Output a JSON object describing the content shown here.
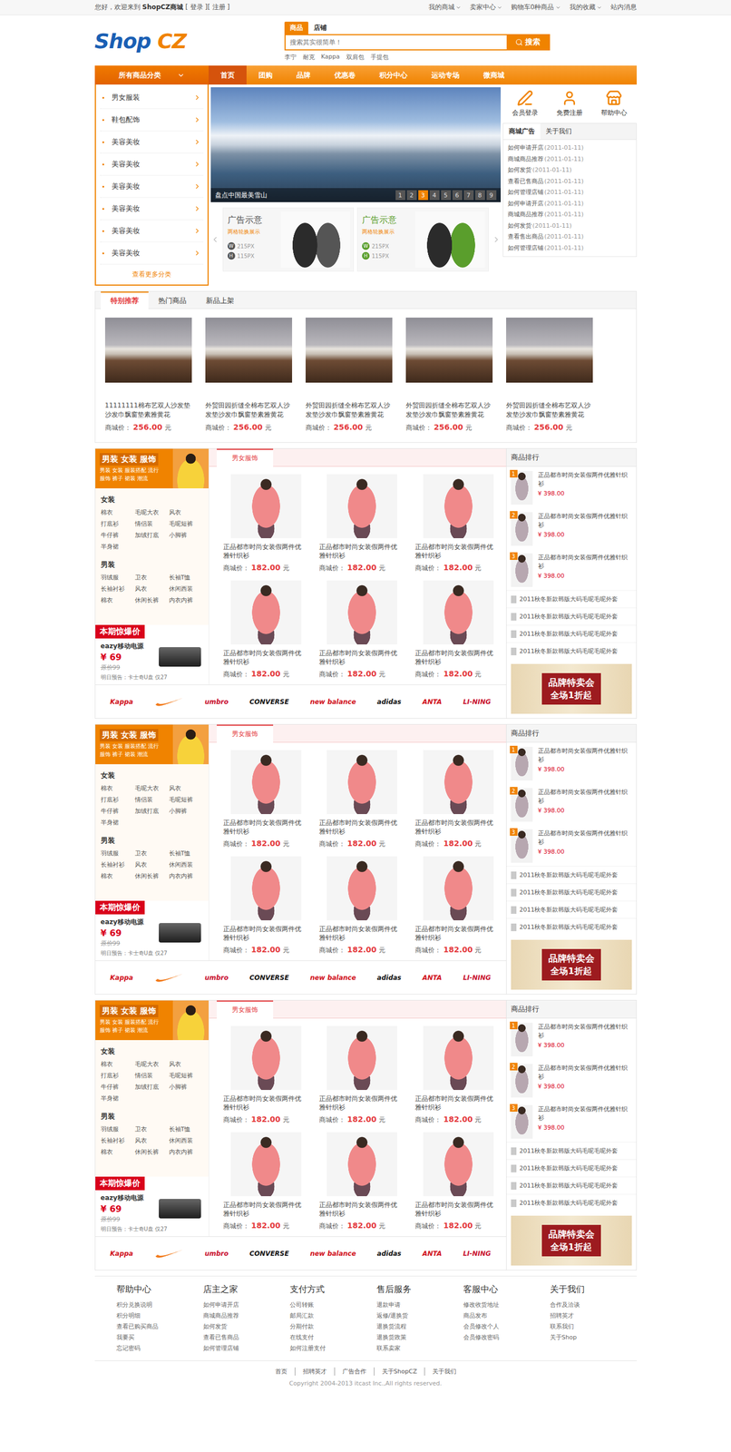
{
  "topbar": {
    "greeting": "您好，欢迎来到",
    "site": "ShopCZ商城",
    "login": "[ 登录 ]",
    "register": "[ 注册 ]",
    "links": [
      {
        "label": "我的商城",
        "menu": true
      },
      {
        "label": "卖家中心",
        "menu": true
      },
      {
        "label": "购物车0种商品",
        "menu": true
      },
      {
        "label": "我的收藏",
        "menu": true
      },
      {
        "label": "站内消息",
        "menu": false
      }
    ]
  },
  "logo": {
    "first": "Shop",
    "second": "CZ"
  },
  "search": {
    "tabs": [
      {
        "label": "商品",
        "selected": true
      },
      {
        "label": "店铺",
        "selected": false
      }
    ],
    "placeholder": "搜索其实很简单！",
    "button": "搜索",
    "hot": [
      "李宁",
      "耐克",
      "Kappa",
      "双肩包",
      "手提包"
    ]
  },
  "nav": {
    "category": "所有商品分类",
    "items": [
      {
        "label": "首页",
        "selected": true
      },
      {
        "label": "团购",
        "selected": false
      },
      {
        "label": "品牌",
        "selected": false
      },
      {
        "label": "优惠卷",
        "selected": false
      },
      {
        "label": "积分中心",
        "selected": false
      },
      {
        "label": "运动专场",
        "selected": false
      },
      {
        "label": "微商城",
        "selected": false
      }
    ]
  },
  "categories": {
    "items": [
      "男女服装",
      "鞋包配饰",
      "美容美妆",
      "美容美妆",
      "美容美妆",
      "美容美妆",
      "美容美妆",
      "美容美妆"
    ],
    "more": "查看更多分类"
  },
  "banner": {
    "caption": "盘点中国最美雪山",
    "pages": [
      {
        "label": "1",
        "selected": false
      },
      {
        "label": "2",
        "selected": false
      },
      {
        "label": "3",
        "selected": true
      },
      {
        "label": "4",
        "selected": false
      },
      {
        "label": "5",
        "selected": false
      },
      {
        "label": "6",
        "selected": false
      },
      {
        "label": "7",
        "selected": false
      },
      {
        "label": "8",
        "selected": false
      },
      {
        "label": "9",
        "selected": false
      }
    ]
  },
  "ads": [
    {
      "title": "广告示意",
      "sub": "两格轮换展示",
      "w": "W",
      "width": "215PX",
      "h": "H",
      "height": "115PX",
      "color": "#555555"
    },
    {
      "title": "广告示意",
      "sub": "两格轮换展示",
      "w": "W",
      "width": "215PX",
      "h": "H",
      "height": "115PX",
      "color": "#5a9e2c"
    }
  ],
  "quick": [
    {
      "label": "会员登录",
      "kind": "login"
    },
    {
      "label": "免费注册",
      "kind": "register"
    },
    {
      "label": "帮助中心",
      "kind": "help"
    }
  ],
  "notice": {
    "tabs": [
      {
        "label": "商城广告",
        "selected": true
      },
      {
        "label": "关于我们",
        "selected": false
      }
    ],
    "items": [
      {
        "title": "如何申请开店",
        "date": "(2011-01-11)"
      },
      {
        "title": "商城商品推荐",
        "date": "(2011-01-11)"
      },
      {
        "title": "如何发货",
        "date": "(2011-01-11)"
      },
      {
        "title": "查看已售商品",
        "date": "(2011-01-11)"
      },
      {
        "title": "如何管理店铺",
        "date": "(2011-01-11)"
      },
      {
        "title": "如何申请开店",
        "date": "(2011-01-11)"
      },
      {
        "title": "商城商品推荐",
        "date": "(2011-01-11)"
      },
      {
        "title": "如何发货",
        "date": "(2011-01-11)"
      },
      {
        "title": "查看售出商品",
        "date": "(2011-01-11)"
      },
      {
        "title": "如何管理店铺",
        "date": "(2011-01-11)"
      }
    ]
  },
  "recommend": {
    "tabs": [
      {
        "label": "特别推荐",
        "selected": true
      },
      {
        "label": "热门商品",
        "selected": false
      },
      {
        "label": "新品上架",
        "selected": false
      }
    ],
    "products": [
      {
        "name": "11111111棉布艺双人沙发垫沙发巾飘窗垫素雅黄花",
        "label": "商城价：",
        "price": "256.00",
        "unit": "元"
      },
      {
        "name": "外贸田园折缝全棉布艺双人沙发垫沙发巾飘窗垫素雅黄花",
        "label": "商城价：",
        "price": "256.00",
        "unit": "元"
      },
      {
        "name": "外贸田园折缝全棉布艺双人沙发垫沙发巾飘窗垫素雅黄花",
        "label": "商城价：",
        "price": "256.00",
        "unit": "元"
      },
      {
        "name": "外贸田园折缝全棉布艺双人沙发垫沙发巾飘窗垫素雅黄花",
        "label": "商城价：",
        "price": "256.00",
        "unit": "元"
      },
      {
        "name": "外贸田园折缝全棉布艺双人沙发垫沙发巾飘窗垫素雅黄花",
        "label": "商城价：",
        "price": "256.00",
        "unit": "元"
      }
    ]
  },
  "floors": [
    {
      "head": {
        "title": "男装 女装 服饰",
        "tags": [
          "男装 女装 服装搭配 流行",
          "服饰 裤子 裙装 潮流"
        ]
      },
      "groups": [
        {
          "title": "女装",
          "items": [
            "棉衣",
            "毛呢大衣",
            "风衣",
            "打底衫",
            "情侣装",
            "毛呢短裤",
            "牛仔裤",
            "加绒打底",
            "小脚裤",
            "半身裙"
          ]
        },
        {
          "title": "男装",
          "items": [
            "羽绒服",
            "卫衣",
            "长袖T恤",
            "长袖衬衫",
            "风衣",
            "休闲西装",
            "棉衣",
            "休闲长裤",
            "内衣内裤"
          ]
        }
      ],
      "deal": {
        "title": "本期惊爆价",
        "name": "eazy移动电源",
        "price": "¥ 69",
        "original": "原价99",
        "preview": "明日预告：卡士奇U盘 仅27"
      },
      "tabs": [
        {
          "label": "男女服饰",
          "selected": true
        }
      ],
      "products": [
        {
          "name": "正品都市时尚女装假两件优雅针织衫",
          "label": "商城价：",
          "price": "182.00",
          "unit": "元"
        },
        {
          "name": "正品都市时尚女装假两件优雅针织衫",
          "label": "商城价：",
          "price": "182.00",
          "unit": "元"
        },
        {
          "name": "正品都市时尚女装假两件优雅针织衫",
          "label": "商城价：",
          "price": "182.00",
          "unit": "元"
        },
        {
          "name": "正品都市时尚女装假两件优雅针织衫",
          "label": "商城价：",
          "price": "182.00",
          "unit": "元"
        },
        {
          "name": "正品都市时尚女装假两件优雅针织衫",
          "label": "商城价：",
          "price": "182.00",
          "unit": "元"
        },
        {
          "name": "正品都市时尚女装假两件优雅针织衫",
          "label": "商城价：",
          "price": "182.00",
          "unit": "元"
        }
      ],
      "ranking": {
        "title": "商品排行",
        "top": [
          {
            "rank": "1",
            "name": "正品都市时尚女装假两件优雅针织衫",
            "price": "¥ 398.00"
          },
          {
            "rank": "2",
            "name": "正品都市时尚女装假两件优雅针织衫",
            "price": "¥ 398.00"
          },
          {
            "rank": "3",
            "name": "正品都市时尚女装假两件优雅针织衫",
            "price": "¥ 398.00"
          }
        ],
        "more": [
          "2011秋冬新款韩版大码毛呢毛呢外套",
          "2011秋冬新款韩版大码毛呢毛呢外套",
          "2011秋冬新款韩版大码毛呢毛呢外套",
          "2011秋冬新款韩版大码毛呢毛呢外套"
        ]
      },
      "promo": {
        "title": "品牌特卖会",
        "sub": "全场1折起"
      },
      "brands": [
        {
          "name": "Kappa",
          "kind": "text",
          "color": "#d0101b"
        },
        {
          "name": "",
          "kind": "swoosh",
          "color": "#f27a1a"
        },
        {
          "name": "umbro",
          "kind": "text",
          "color": "#c8102e"
        },
        {
          "name": "CONVERSE",
          "kind": "text",
          "color": "#111111"
        },
        {
          "name": "new balance",
          "kind": "text",
          "color": "#d0101b"
        },
        {
          "name": "adidas",
          "kind": "text",
          "color": "#111111"
        },
        {
          "name": "ANTA",
          "kind": "text",
          "color": "#d0101b"
        },
        {
          "name": "LI-NING",
          "kind": "text",
          "color": "#c8102e"
        }
      ]
    },
    {
      "head": {
        "title": "男装 女装 服饰",
        "tags": [
          "男装 女装 服装搭配 流行",
          "服饰 裤子 裙装 潮流"
        ]
      },
      "groups": [
        {
          "title": "女装",
          "items": [
            "棉衣",
            "毛呢大衣",
            "风衣",
            "打底衫",
            "情侣装",
            "毛呢短裤",
            "牛仔裤",
            "加绒打底",
            "小脚裤",
            "半身裙"
          ]
        },
        {
          "title": "男装",
          "items": [
            "羽绒服",
            "卫衣",
            "长袖T恤",
            "长袖衬衫",
            "风衣",
            "休闲西装",
            "棉衣",
            "休闲长裤",
            "内衣内裤"
          ]
        }
      ],
      "deal": {
        "title": "本期惊爆价",
        "name": "eazy移动电源",
        "price": "¥ 69",
        "original": "原价99",
        "preview": "明日预告：卡士奇U盘 仅27"
      },
      "tabs": [
        {
          "label": "男女服饰",
          "selected": true
        }
      ],
      "products": [
        {
          "name": "正品都市时尚女装假两件优雅针织衫",
          "label": "商城价：",
          "price": "182.00",
          "unit": "元"
        },
        {
          "name": "正品都市时尚女装假两件优雅针织衫",
          "label": "商城价：",
          "price": "182.00",
          "unit": "元"
        },
        {
          "name": "正品都市时尚女装假两件优雅针织衫",
          "label": "商城价：",
          "price": "182.00",
          "unit": "元"
        },
        {
          "name": "正品都市时尚女装假两件优雅针织衫",
          "label": "商城价：",
          "price": "182.00",
          "unit": "元"
        },
        {
          "name": "正品都市时尚女装假两件优雅针织衫",
          "label": "商城价：",
          "price": "182.00",
          "unit": "元"
        },
        {
          "name": "正品都市时尚女装假两件优雅针织衫",
          "label": "商城价：",
          "price": "182.00",
          "unit": "元"
        }
      ],
      "ranking": {
        "title": "商品排行",
        "top": [
          {
            "rank": "1",
            "name": "正品都市时尚女装假两件优雅针织衫",
            "price": "¥ 398.00"
          },
          {
            "rank": "2",
            "name": "正品都市时尚女装假两件优雅针织衫",
            "price": "¥ 398.00"
          },
          {
            "rank": "3",
            "name": "正品都市时尚女装假两件优雅针织衫",
            "price": "¥ 398.00"
          }
        ],
        "more": [
          "2011秋冬新款韩版大码毛呢毛呢外套",
          "2011秋冬新款韩版大码毛呢毛呢外套",
          "2011秋冬新款韩版大码毛呢毛呢外套",
          "2011秋冬新款韩版大码毛呢毛呢外套"
        ]
      },
      "promo": {
        "title": "品牌特卖会",
        "sub": "全场1折起"
      },
      "brands": [
        {
          "name": "Kappa",
          "kind": "text",
          "color": "#d0101b"
        },
        {
          "name": "",
          "kind": "swoosh",
          "color": "#f27a1a"
        },
        {
          "name": "umbro",
          "kind": "text",
          "color": "#c8102e"
        },
        {
          "name": "CONVERSE",
          "kind": "text",
          "color": "#111111"
        },
        {
          "name": "new balance",
          "kind": "text",
          "color": "#d0101b"
        },
        {
          "name": "adidas",
          "kind": "text",
          "color": "#111111"
        },
        {
          "name": "ANTA",
          "kind": "text",
          "color": "#d0101b"
        },
        {
          "name": "LI-NING",
          "kind": "text",
          "color": "#c8102e"
        }
      ]
    },
    {
      "head": {
        "title": "男装 女装 服饰",
        "tags": [
          "男装 女装 服装搭配 流行",
          "服饰 裤子 裙装 潮流"
        ]
      },
      "groups": [
        {
          "title": "女装",
          "items": [
            "棉衣",
            "毛呢大衣",
            "风衣",
            "打底衫",
            "情侣装",
            "毛呢短裤",
            "牛仔裤",
            "加绒打底",
            "小脚裤",
            "半身裙"
          ]
        },
        {
          "title": "男装",
          "items": [
            "羽绒服",
            "卫衣",
            "长袖T恤",
            "长袖衬衫",
            "风衣",
            "休闲西装",
            "棉衣",
            "休闲长裤",
            "内衣内裤"
          ]
        }
      ],
      "deal": {
        "title": "本期惊爆价",
        "name": "eazy移动电源",
        "price": "¥ 69",
        "original": "原价99",
        "preview": "明日预告：卡士奇U盘 仅27"
      },
      "tabs": [
        {
          "label": "男女服饰",
          "selected": true
        }
      ],
      "products": [
        {
          "name": "正品都市时尚女装假两件优雅针织衫",
          "label": "商城价：",
          "price": "182.00",
          "unit": "元"
        },
        {
          "name": "正品都市时尚女装假两件优雅针织衫",
          "label": "商城价：",
          "price": "182.00",
          "unit": "元"
        },
        {
          "name": "正品都市时尚女装假两件优雅针织衫",
          "label": "商城价：",
          "price": "182.00",
          "unit": "元"
        },
        {
          "name": "正品都市时尚女装假两件优雅针织衫",
          "label": "商城价：",
          "price": "182.00",
          "unit": "元"
        },
        {
          "name": "正品都市时尚女装假两件优雅针织衫",
          "label": "商城价：",
          "price": "182.00",
          "unit": "元"
        },
        {
          "name": "正品都市时尚女装假两件优雅针织衫",
          "label": "商城价：",
          "price": "182.00",
          "unit": "元"
        }
      ],
      "ranking": {
        "title": "商品排行",
        "top": [
          {
            "rank": "1",
            "name": "正品都市时尚女装假两件优雅针织衫",
            "price": "¥ 398.00"
          },
          {
            "rank": "2",
            "name": "正品都市时尚女装假两件优雅针织衫",
            "price": "¥ 398.00"
          },
          {
            "rank": "3",
            "name": "正品都市时尚女装假两件优雅针织衫",
            "price": "¥ 398.00"
          }
        ],
        "more": [
          "2011秋冬新款韩版大码毛呢毛呢外套",
          "2011秋冬新款韩版大码毛呢毛呢外套",
          "2011秋冬新款韩版大码毛呢毛呢外套",
          "2011秋冬新款韩版大码毛呢毛呢外套"
        ]
      },
      "promo": {
        "title": "品牌特卖会",
        "sub": "全场1折起"
      },
      "brands": [
        {
          "name": "Kappa",
          "kind": "text",
          "color": "#d0101b"
        },
        {
          "name": "",
          "kind": "swoosh",
          "color": "#f27a1a"
        },
        {
          "name": "umbro",
          "kind": "text",
          "color": "#c8102e"
        },
        {
          "name": "CONVERSE",
          "kind": "text",
          "color": "#111111"
        },
        {
          "name": "new balance",
          "kind": "text",
          "color": "#d0101b"
        },
        {
          "name": "adidas",
          "kind": "text",
          "color": "#111111"
        },
        {
          "name": "ANTA",
          "kind": "text",
          "color": "#d0101b"
        },
        {
          "name": "LI-NING",
          "kind": "text",
          "color": "#c8102e"
        }
      ]
    }
  ],
  "footer": {
    "columns": [
      {
        "title": "帮助中心",
        "links": [
          "积分兑换说明",
          "积分明细",
          "查看已购买商品",
          "我要买",
          "忘记密码"
        ]
      },
      {
        "title": "店主之家",
        "links": [
          "如何申请开店",
          "商城商品推荐",
          "如何发货",
          "查看已售商品",
          "如何管理店铺"
        ]
      },
      {
        "title": "支付方式",
        "links": [
          "公司转账",
          "邮局汇款",
          "分期付款",
          "在线支付",
          "如何注册支付"
        ]
      },
      {
        "title": "售后服务",
        "links": [
          "退款申请",
          "返修/退换货",
          "退换货流程",
          "退换货政策",
          "联系卖家"
        ]
      },
      {
        "title": "客服中心",
        "links": [
          "修改收货地址",
          "商品发布",
          "会员修改个人",
          "会员修改密码"
        ]
      },
      {
        "title": "关于我们",
        "links": [
          "合作及洽谈",
          "招聘英才",
          "联系我们",
          "关于Shop"
        ]
      }
    ],
    "bottom": [
      "首页",
      "招聘英才",
      "广告合作",
      "关于ShopCZ",
      "关于我们"
    ],
    "copyright": "Copyright 2004-2013 itcast Inc.,All rights reserved."
  }
}
